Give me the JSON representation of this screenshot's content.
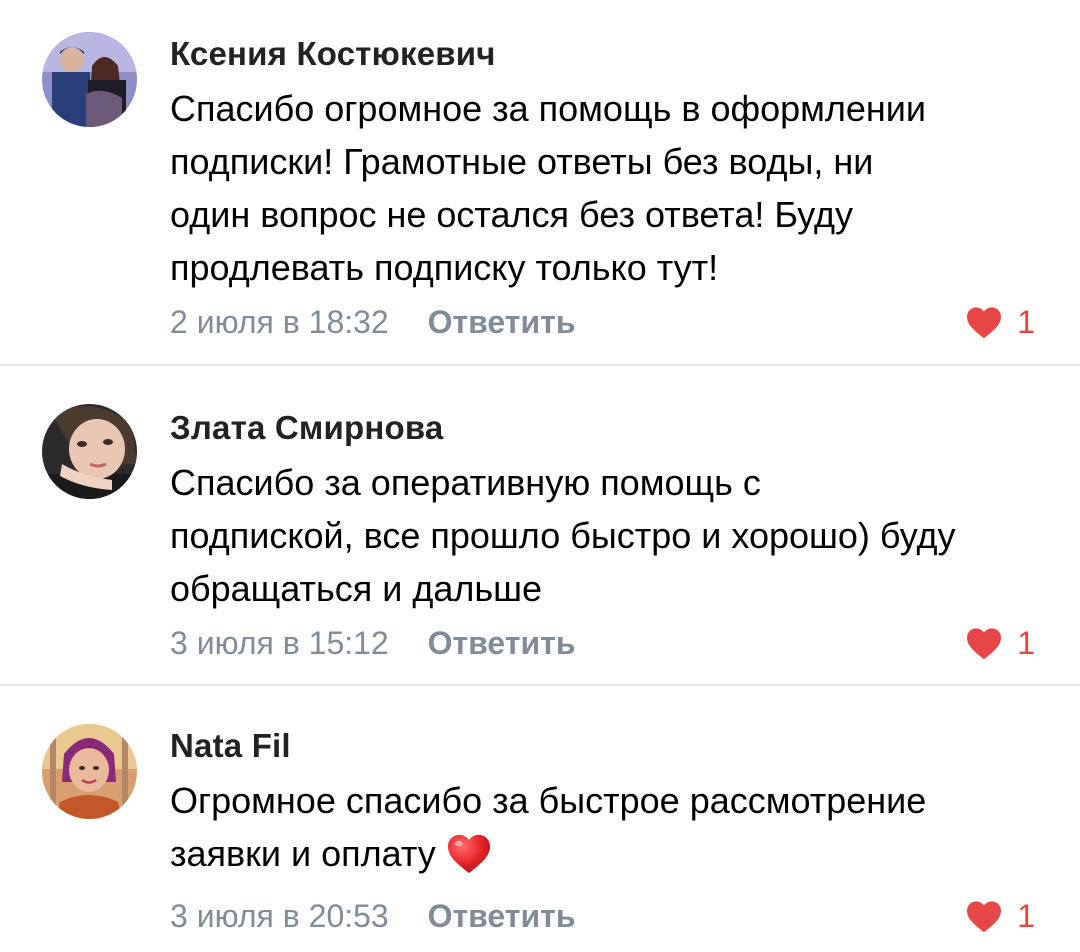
{
  "comments": [
    {
      "author": "Ксения Костюкевич",
      "text_lines": [
        "Спасибо огромное за помощь в оформлении",
        "подписки! Грамотные ответы без воды, ни",
        "один вопрос не остался без ответа! Буду",
        "продлевать подписку только тут!"
      ],
      "date": "2 июля в 18:32",
      "reply_label": "Ответить",
      "likes": "1"
    },
    {
      "author": "Злата Смирнова",
      "text_lines": [
        "Спасибо за оперативную помощь с",
        "подпиской, все прошло быстро и хорошо) буду",
        "обращаться и дальше"
      ],
      "date": "3 июля в 15:12",
      "reply_label": "Ответить",
      "likes": "1"
    },
    {
      "author": "Nata Fil",
      "text_lines": [
        "Огромное спасибо за быстрое рассмотрение",
        "заявки и оплату"
      ],
      "emoji": "red-heart-emoji",
      "date": "3 июля в 20:53",
      "reply_label": "Ответить",
      "likes": "1"
    }
  ],
  "colors": {
    "meta": "#818c99",
    "like": "#e64646",
    "divider": "#e3e4e8",
    "author": "#222222"
  },
  "icons": {
    "like": "heart-icon",
    "avatar": "avatar"
  }
}
